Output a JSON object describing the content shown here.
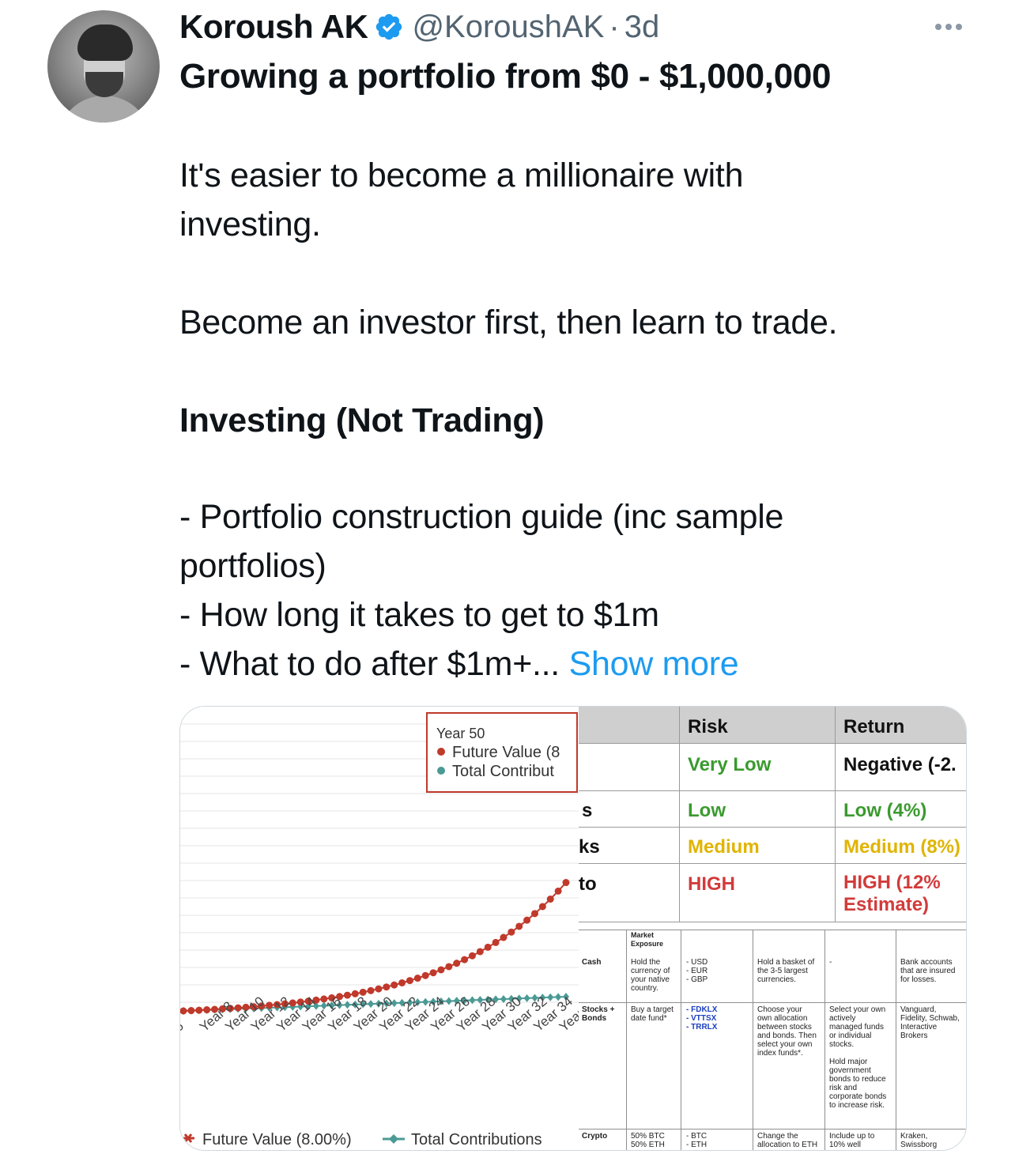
{
  "tweet": {
    "author_name": "Koroush AK",
    "handle": "@KoroushAK",
    "separator": "·",
    "time": "3d",
    "headline": "Growing a portfolio from $0 - $1,000,000",
    "lines": [
      "It's easier to become a millionaire with",
      "investing.",
      "Become an investor first, then learn to trade.",
      "Investing (Not Trading)",
      "- Portfolio construction guide (inc sample",
      "portfolios)",
      "- How long it takes to get to $1m",
      "- What to do after $1m+..."
    ],
    "show_more": "Show more"
  },
  "icons": {
    "verified": "verified-badge-icon",
    "more": "more-options-icon",
    "accent_color": "#1d9bf0"
  },
  "chart": {
    "tooltip_title": "Year 50",
    "tooltip_series_1": "Future Value (8",
    "tooltip_series_2": "Total Contribut",
    "legend_1": "Future Value (8.00%)",
    "legend_2": "Total Contributions",
    "x_labels": [
      "6",
      "Year 8",
      "Year 10",
      "Year 12",
      "Year 14",
      "Year 16",
      "Year 18",
      "Year 20",
      "Year 22",
      "Year 24",
      "Year 26",
      "Year 28",
      "Year 30",
      "Year 32",
      "Year 34",
      "Year"
    ],
    "color_future": "#c0392b",
    "color_contrib": "#4a9a95"
  },
  "chart_data": {
    "type": "line",
    "series": [
      {
        "name": "Future Value (8.00%)",
        "color": "#c0392b"
      },
      {
        "name": "Total Contributions",
        "color": "#4a9a95"
      }
    ],
    "x": [
      "6",
      "Year 8",
      "Year 10",
      "Year 12",
      "Year 14",
      "Year 16",
      "Year 18",
      "Year 20",
      "Year 22",
      "Year 24",
      "Year 26",
      "Year 28",
      "Year 30",
      "Year 32",
      "Year 34"
    ],
    "grid": true,
    "legend": "bottom"
  },
  "risk_table": {
    "headers": [
      "Risk",
      "Return"
    ],
    "rows": [
      {
        "label": "",
        "risk": "Very Low",
        "risk_color": "#3a9a2e",
        "ret": "Negative (-2.",
        "ret_color": "#111111"
      },
      {
        "label": "s",
        "risk": "Low",
        "risk_color": "#3a9a2e",
        "ret": "Low (4%)",
        "ret_color": "#3a9a2e"
      },
      {
        "label": "ks",
        "risk": "Medium",
        "risk_color": "#e0b400",
        "ret": "Medium (8%)",
        "ret_color": "#e0b400"
      },
      {
        "label": "to",
        "risk": "HIGH",
        "risk_color": "#d23b3b",
        "ret": "HIGH (12%",
        "ret_color": "#d23b3b",
        "ret2": "Estimate)"
      }
    ]
  },
  "portfolio_table": {
    "header_market": "Market\nExposure",
    "rows": [
      {
        "asset": "Cash",
        "market": "Hold the\ncurrency of\nyour native\ncountry.",
        "tickers": "- USD\n- EUR\n- GBP",
        "col4": "Hold a basket of\nthe 3-5 largest\ncurrencies.",
        "col5": "-",
        "col6": "Bank accounts\nthat are insured\nfor losses."
      },
      {
        "asset": "Stocks +\nBonds",
        "market": "Buy a target\ndate fund*",
        "tickers": "- FDKLX\n- VTTSX\n- TRRLX",
        "col4": "Choose your\nown allocation\nbetween stocks\nand bonds. Then\nselect your own\nindex funds*.",
        "col5": "Select your own\nactively\nmanaged funds\nor individual\nstocks.\n\nHold major\ngovernment\nbonds to reduce\nrisk and\ncorporate bonds\nto increase risk.",
        "col6": "Vanguard,\nFidelity, Schwab,\nInteractive\nBrokers"
      },
      {
        "asset": "Crypto",
        "market": "50% BTC\n50% ETH",
        "tickers": "- BTC\n- ETH",
        "col4": "Change the\nallocation to ETH",
        "col5": "Include up to\n10% well",
        "col6": "Kraken,\nSwissborg"
      }
    ]
  }
}
